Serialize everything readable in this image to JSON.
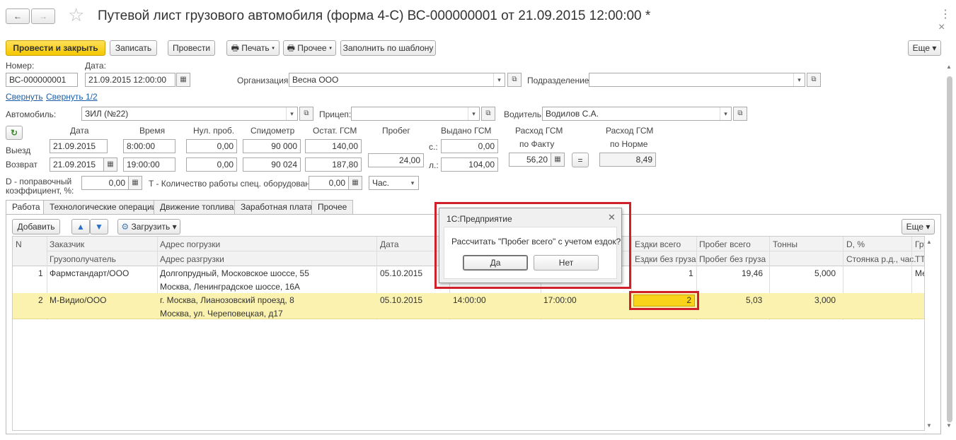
{
  "window": {
    "title": "Путевой лист грузового автомобиля (форма 4-С) ВС-000000001 от 21.09.2015 12:00:00 *",
    "back_icon": "←",
    "forward_icon": "→",
    "star_icon": "☆",
    "more_icon": "⋮",
    "close_icon": "×"
  },
  "toolbar": {
    "post_close": "Провести и закрыть",
    "save": "Записать",
    "post": "Провести",
    "print": "Печать",
    "other": "Прочее",
    "fill_template": "Заполнить по шаблону",
    "more": "Еще"
  },
  "header": {
    "number_label": "Номер:",
    "number_value": "ВС-000000001",
    "date_label": "Дата:",
    "date_value": "21.09.2015 12:00:00",
    "org_label": "Организация:",
    "org_value": "Весна ООО",
    "dept_label": "Подразделение:",
    "dept_value": "",
    "collapse": "Свернуть",
    "collapse_half": "Свернуть 1/2",
    "car_label": "Автомобиль:",
    "car_value": "ЗИЛ (№22)",
    "trailer_label": "Прицеп:",
    "trailer_value": "",
    "driver_label": "Водитель:",
    "driver_value": "Водилов С.А."
  },
  "grid": {
    "col_date": "Дата",
    "col_time": "Время",
    "col_zero": "Нул. проб.",
    "col_odo": "Спидометр",
    "col_fuel": "Остат. ГСМ",
    "col_run": "Пробег",
    "col_issued": "Выдано ГСМ",
    "col_fact_1": "Расход ГСМ",
    "col_fact_2": "по Факту",
    "col_norm_1": "Расход ГСМ",
    "col_norm_2": "по Норме",
    "row_out": "Выезд",
    "row_back": "Возврат",
    "out_date": "21.09.2015",
    "out_time": "8:00:00",
    "out_zero": "0,00",
    "out_odo": "90 000",
    "out_fuel": "140,00",
    "back_date": "21.09.2015",
    "back_time": "19:00:00",
    "back_zero": "0,00",
    "back_odo": "90 024",
    "back_fuel": "187,80",
    "run_value": "24,00",
    "issued_s_label": "с.:",
    "issued_s": "0,00",
    "issued_l_label": "л.:",
    "issued_l": "104,00",
    "fact_value": "56,20",
    "equals": "=",
    "norm_value": "8,49",
    "d_label_1": "D - поправочный",
    "d_label_2": "коэффициент, %:",
    "d_value": "0,00",
    "t_label": "T - Количество работы спец. оборудования:",
    "t_value": "0,00",
    "t_unit": "Час."
  },
  "tabs": [
    "Работа",
    "Технологические операции",
    "Движение топлива",
    "Заработная плата",
    "Прочее"
  ],
  "work_toolbar": {
    "add": "Добавить",
    "up_icon": "▲",
    "down_icon": "▼",
    "load": "Загрузить",
    "more": "Еще"
  },
  "table": {
    "headers1": [
      "N",
      "Заказчик",
      "Адрес погрузки",
      "Дата",
      "",
      "",
      "Ездки всего",
      "Пробег всего",
      "Тонны",
      "D, %",
      "Гру"
    ],
    "headers2": [
      "",
      "Грузополучатель",
      "Адрес разгрузки",
      "",
      "",
      "",
      "Ездки без груза",
      "Пробег без груза",
      "",
      "Стоянка р.д., час.",
      "ТТ"
    ],
    "rows": [
      {
        "n": "1",
        "customer": "Фармстандарт/ООО",
        "load_addr": "Долгопрудный, Московское шоссе, 55",
        "unload_addr": "Москва, Ленинградское шоссе, 16А",
        "date": "05.10.2015",
        "t1": "",
        "t2": "",
        "trips": "1",
        "mileage": "19,46",
        "tons": "5,000",
        "last": "Ме"
      },
      {
        "n": "2",
        "customer": "М-Видио/ООО",
        "load_addr": "г. Москва, Лианозовский проезд, 8",
        "unload_addr": "Москва, ул. Череповецкая, д17",
        "date": "05.10.2015",
        "t1": "14:00:00",
        "t2": "17:00:00",
        "trips": "2",
        "mileage": "5,03",
        "tons": "3,000",
        "last": ""
      }
    ]
  },
  "dialog": {
    "title": "1С:Предприятие",
    "message": "Рассчитать \"Пробег всего\" с учетом ездок?",
    "yes": "Да",
    "no": "Нет",
    "close_icon": "✕"
  },
  "colors": {
    "highlight_red": "#d0202a",
    "selected_row": "#fbf2b0",
    "edit_cell": "#f9d21a",
    "primary_button": "#f5c800"
  }
}
